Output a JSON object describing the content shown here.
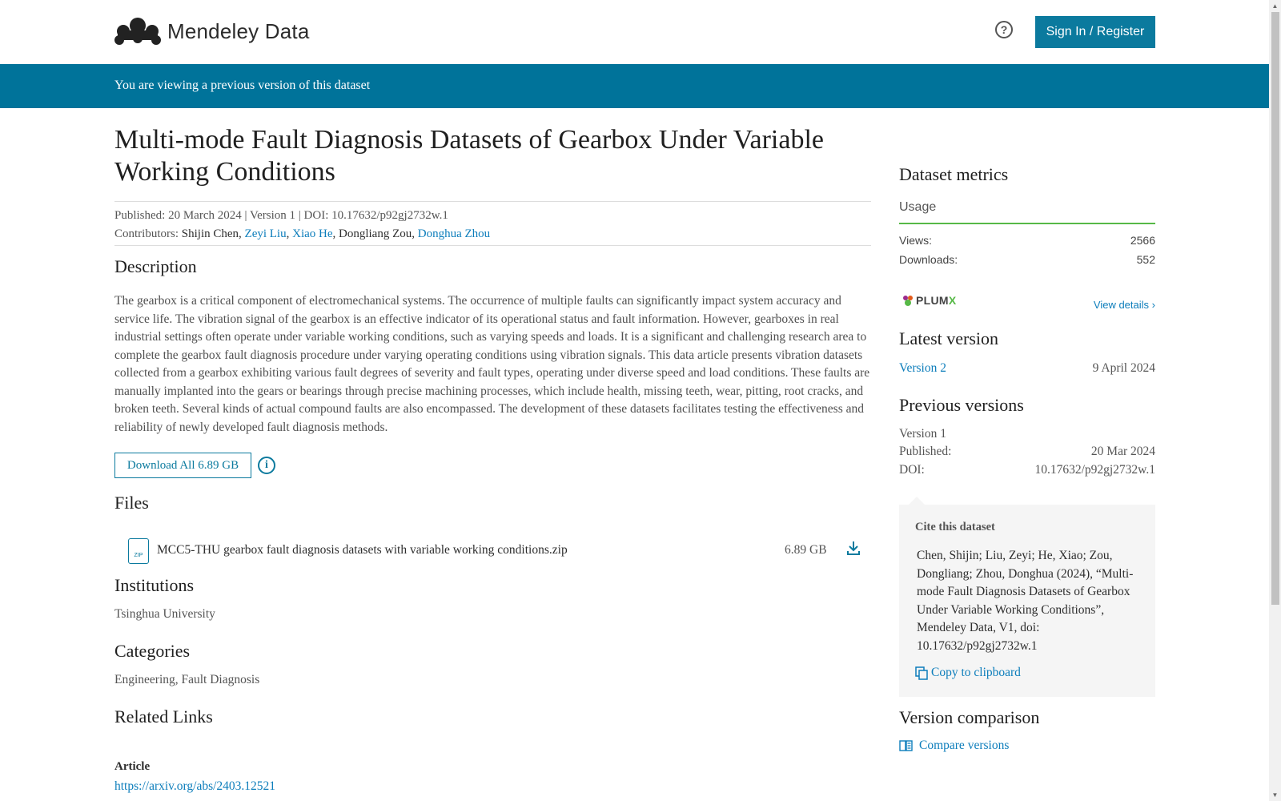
{
  "header": {
    "logo_text": "Mendeley Data",
    "help_icon": "question-circle-icon",
    "signin_label": "Sign In / Register"
  },
  "banner": {
    "text": "You are viewing a previous version of this dataset"
  },
  "dataset": {
    "title": "Multi-mode Fault Diagnosis Datasets of Gearbox Under Variable Working Conditions",
    "published_line": "Published: 20 March 2024 | Version 1 | DOI: 10.17632/p92gj2732w.1",
    "contributors_label": "Contributors:",
    "contributors": [
      {
        "name": "Shijin Chen",
        "link": false
      },
      {
        "name": "Zeyi Liu",
        "link": true
      },
      {
        "name": "Xiao He",
        "link": true
      },
      {
        "name": "Dongliang Zou",
        "link": false
      },
      {
        "name": "Donghua Zhou",
        "link": true
      }
    ],
    "description_heading": "Description",
    "description": "The gearbox is a critical component of electromechanical systems. The occurrence of multiple faults can significantly impact system accuracy and service life. The vibration signal of the gearbox is an effective indicator of its operational status and fault information. However, gearboxes in real industrial settings often operate under variable working conditions, such as varying speeds and loads. It is a significant and challenging research area to complete the gearbox fault diagnosis procedure under varying operating conditions using vibration signals. This data article presents vibration datasets collected from a gearbox exhibiting various fault degrees of severity and fault types, operating under diverse speed and load conditions. These faults are manually implanted into the gears or bearings through precise machining processes, which include health, missing teeth, wear, pitting, root cracks, and broken teeth. Several kinds of actual compound faults are also encompassed. The development of these datasets facilitates testing the effectiveness and reliability of newly developed fault diagnosis methods.",
    "download_all_label": "Download All 6.89 GB",
    "files_heading": "Files",
    "files": [
      {
        "name": "MCC5-THU gearbox fault diagnosis datasets with variable working conditions.zip",
        "size": "6.89 GB",
        "icon_text": "ZIP"
      }
    ],
    "institutions_heading": "Institutions",
    "institutions": "Tsinghua University",
    "categories_heading": "Categories",
    "categories": "Engineering, Fault Diagnosis",
    "related_heading": "Related Links",
    "article_label": "Article",
    "article_url": "https://arxiv.org/abs/2403.12521"
  },
  "sidebar": {
    "metrics_heading": "Dataset metrics",
    "usage_label": "Usage",
    "views_label": "Views:",
    "views_value": "2566",
    "downloads_label": "Downloads:",
    "downloads_value": "552",
    "plumx_prefix": "PLUM",
    "plumx_suffix": "X",
    "view_details_label": "View details",
    "latest_heading": "Latest version",
    "latest_version_label": "Version 2",
    "latest_version_date": "9 April 2024",
    "previous_heading": "Previous versions",
    "prev_version_label": "Version 1",
    "prev_published_label": "Published:",
    "prev_published_value": "20 Mar 2024",
    "prev_doi_label": "DOI:",
    "prev_doi_value": "10.17632/p92gj2732w.1",
    "cite_heading": "Cite this dataset",
    "cite_text": "Chen, Shijin; Liu, Zeyi; He, Xiao; Zou, Dongliang; Zhou, Donghua (2024), “Multi-mode Fault Diagnosis Datasets of Gearbox Under Variable Working Conditions”, Mendeley Data, V1, doi: 10.17632/p92gj2732w.1",
    "copy_label": "Copy to clipboard",
    "comparison_heading": "Version comparison",
    "compare_label": "Compare versions"
  },
  "colors": {
    "primary": "#0b7a9e",
    "banner": "#00739a",
    "link": "#0c7dbb",
    "usage_underline": "#57b947"
  }
}
